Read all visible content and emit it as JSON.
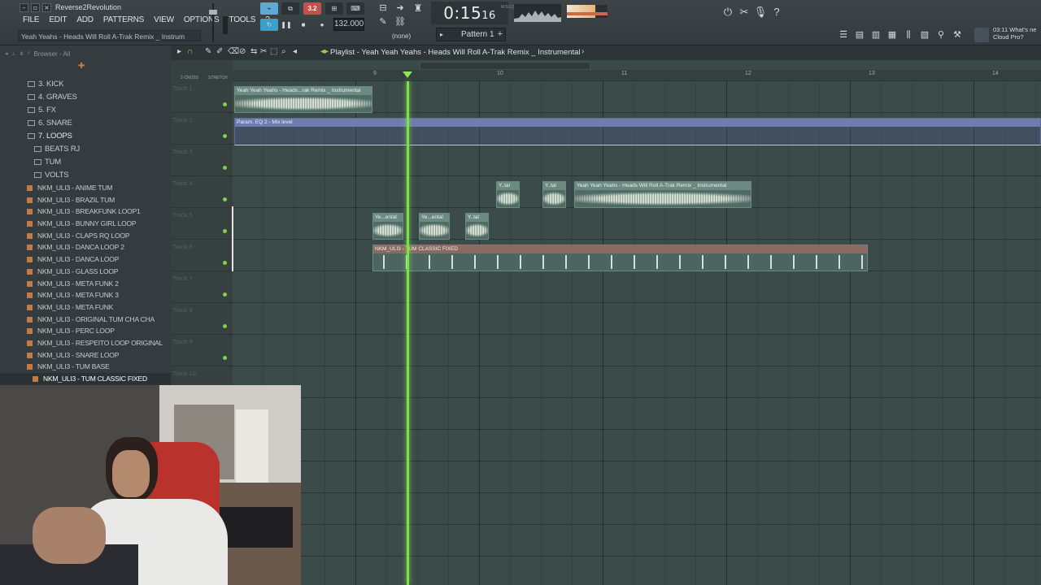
{
  "app": {
    "title": "Reverse2Revolution",
    "hint": "Yeah Yeahs - Heads Will Roll A-Trak Remix _ Instrum"
  },
  "menu": [
    "FILE",
    "EDIT",
    "ADD",
    "PATTERNS",
    "VIEW",
    "OPTIONS",
    "TOOLS",
    "?"
  ],
  "transport": {
    "song_mode_badge": "3.2",
    "tempo": "132.000",
    "time_main": "0:15",
    "time_sub": "16",
    "time_unit_label": "M:S:CS",
    "pattern_none": "(none)",
    "pattern_name": "Pattern 1"
  },
  "news": {
    "line1": "03:11 What's ne",
    "line2": "Cloud Pro?"
  },
  "browser": {
    "header": "Browser - All",
    "folders": [
      {
        "label": "3. KICK",
        "indent": 0
      },
      {
        "label": "4. GRAVES",
        "indent": 0
      },
      {
        "label": "5. FX",
        "indent": 0
      },
      {
        "label": "6. SNARE",
        "indent": 0
      },
      {
        "label": "7. LOOPS",
        "indent": 0
      },
      {
        "label": "BEATS RJ",
        "indent": 1
      },
      {
        "label": "TUM",
        "indent": 1
      },
      {
        "label": "VOLTS",
        "indent": 1
      }
    ],
    "files": [
      "NKM_ULI3 - ANIME TUM",
      "NKM_ULI3 - BRAZIL TUM",
      "NKM_ULI3 - BREAKFUNK LOOP1",
      "NKM_ULI3 - BUNNY GIRL LOOP",
      "NKM_ULI3 - CLAPS RQ LOOP",
      "NKM_ULI3 - DANCA LOOP 2",
      "NKM_ULI3 - DANCA LOOP",
      "NKM_ULI3 - GLASS LOOP",
      "NKM_ULI3 - META FUNK 2",
      "NKM_ULI3 - META FUNK 3",
      "NKM_ULI3 - META FUNK",
      "NKM_ULI3 - ORIGINAL TUM CHA CHA",
      "NKM_ULI3 - PERC LOOP",
      "NKM_ULI3 - RESPEITO LOOP ORIGINAL",
      "NKM_ULI3 - SNARE LOOP",
      "NKM_ULI3 - TUM BASE",
      "NKM_ULI3 - TUM CLASSIC FIXED"
    ]
  },
  "playlist": {
    "title": "Playlist - Yeah Yeah Yeahs - Heads Will Roll A-Trak Remix _ Instrumental",
    "mode_labels": [
      "2-CROSS",
      "STRETCH"
    ],
    "bars": [
      "9",
      "10",
      "11",
      "12",
      "13",
      "14"
    ],
    "tracks": [
      "Track 1",
      "Track 2",
      "Track 3",
      "Track 4",
      "Track 5",
      "Track 6",
      "Track 7",
      "Track 8",
      "Track 9",
      "Track 10"
    ],
    "clips": {
      "t1": "Yeah Yeah Yeahs - Heads...rak Remix _ Instrumental",
      "t2": "Param. EQ 2 - Mix level",
      "t4a": "Y..tal",
      "t4b": "Y..tal",
      "t4c": "Yeah Yeah Yeahs - Heads Will Roll A-Trak Remix _ Instrumental",
      "t5a": "Ye...ental",
      "t5b": "Ye...ental",
      "t5c": "Y..tal",
      "t6": "NKM_ULI3 - TUM CLASSIC FIXED"
    }
  },
  "colors": {
    "playhead": "#7ee04a",
    "accent_blue": "#5fa9d6",
    "record_red": "#c94d4d"
  }
}
